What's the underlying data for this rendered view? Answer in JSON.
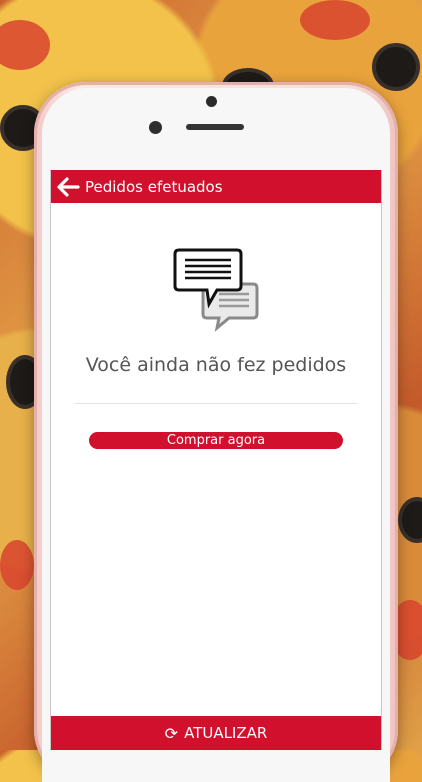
{
  "header": {
    "title": "Pedidos efetuados"
  },
  "empty_state": {
    "message": "Você ainda não fez pedidos"
  },
  "actions": {
    "buy_label": "Comprar agora",
    "refresh_label": "ATUALIZAR"
  },
  "colors": {
    "brand": "#d0102c",
    "text_muted": "#555555"
  },
  "icons": {
    "back": "arrow-left-icon",
    "empty": "chat-bubbles-icon",
    "refresh": "refresh-icon"
  }
}
